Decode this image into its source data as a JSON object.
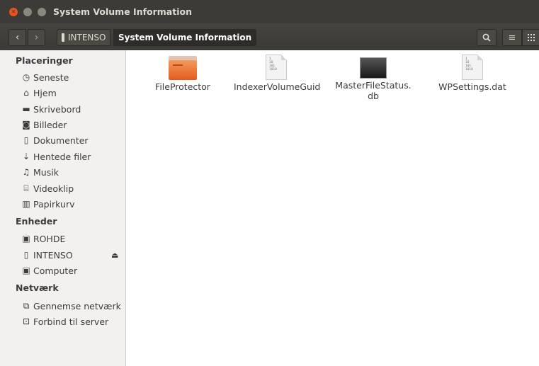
{
  "window": {
    "title": "System Volume Information"
  },
  "toolbar": {
    "drive_label": "INTENSO",
    "current_folder": "System Volume Information"
  },
  "sidebar": {
    "places_header": "Placeringer",
    "places": [
      {
        "label": "Seneste",
        "icon": "clock-icon"
      },
      {
        "label": "Hjem",
        "icon": "home-icon"
      },
      {
        "label": "Skrivebord",
        "icon": "desktop-folder-icon"
      },
      {
        "label": "Billeder",
        "icon": "camera-icon"
      },
      {
        "label": "Dokumenter",
        "icon": "document-icon"
      },
      {
        "label": "Hentede filer",
        "icon": "download-icon"
      },
      {
        "label": "Musik",
        "icon": "music-icon"
      },
      {
        "label": "Videoklip",
        "icon": "film-icon"
      },
      {
        "label": "Papirkurv",
        "icon": "trash-icon"
      }
    ],
    "devices_header": "Enheder",
    "devices": [
      {
        "label": "ROHDE",
        "icon": "drive-icon"
      },
      {
        "label": "INTENSO",
        "icon": "usb-drive-icon"
      },
      {
        "label": "Computer",
        "icon": "drive-icon"
      }
    ],
    "network_header": "Netværk",
    "network": [
      {
        "label": "Gennemse netværk",
        "icon": "network-icon"
      },
      {
        "label": "Forbind til server",
        "icon": "server-icon"
      }
    ]
  },
  "files": [
    {
      "name": "FileProtector",
      "type": "folder"
    },
    {
      "name": "IndexerVolumeGuid",
      "type": "binary"
    },
    {
      "name": "MasterFileStatus.\ndb",
      "type": "black"
    },
    {
      "name": "WPSettings.dat",
      "type": "binary"
    }
  ],
  "doc_glyph": [
    "1",
    "10",
    "101",
    "1010"
  ],
  "colors": {
    "accent": "#e95420",
    "titlebar": "#3c3b37",
    "folder": "#f08c4c"
  }
}
